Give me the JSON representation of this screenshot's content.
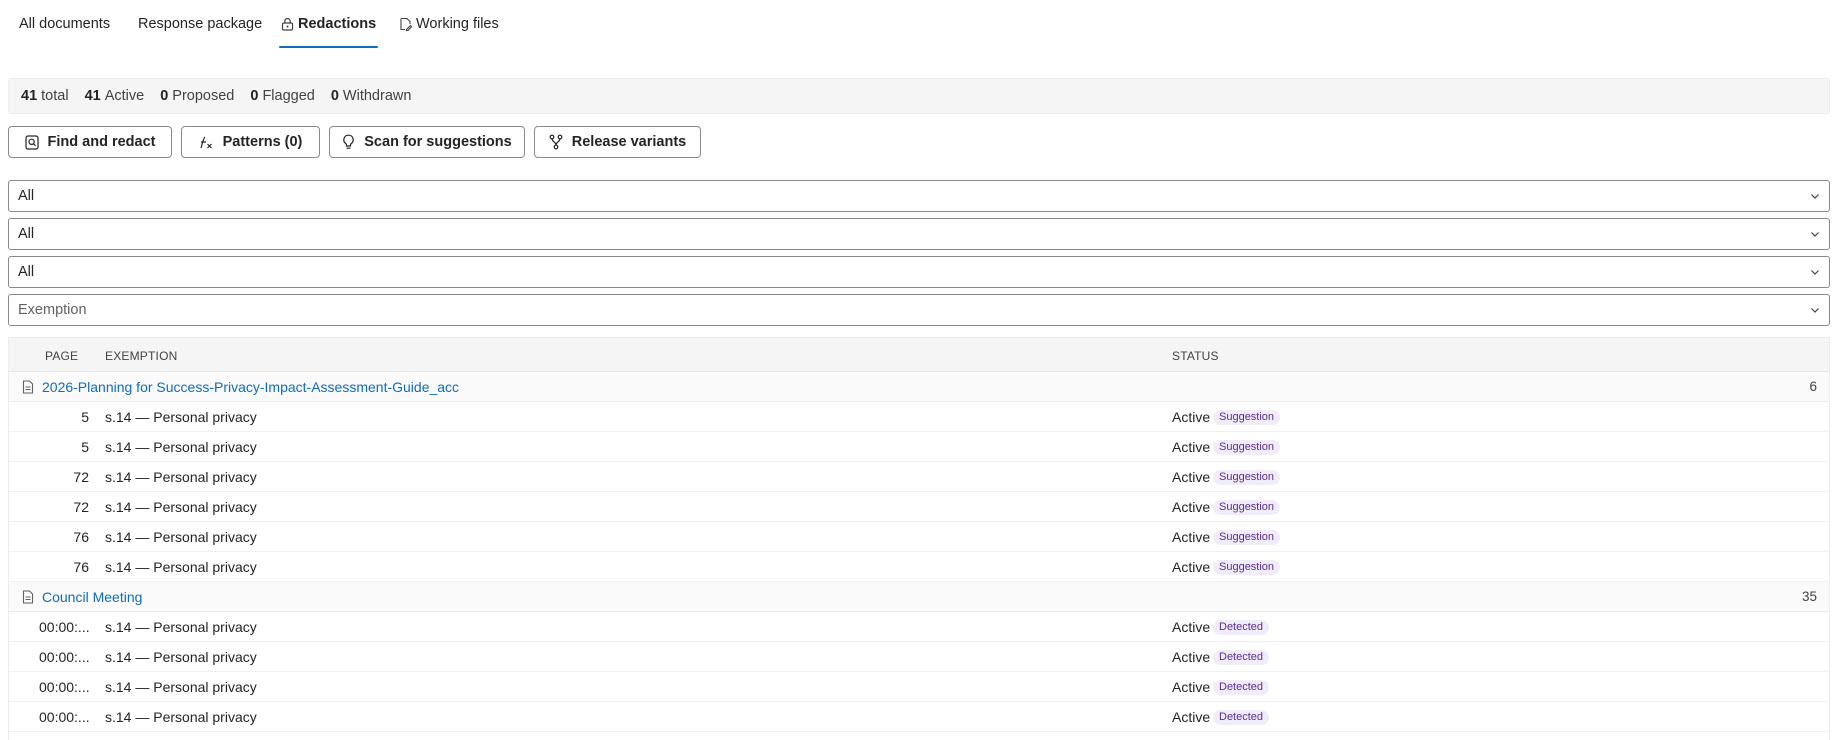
{
  "tabs": [
    {
      "label": "All documents",
      "icon": null
    },
    {
      "label": "Response package",
      "icon": null
    },
    {
      "label": "Redactions",
      "icon": "lock-icon",
      "active": true
    },
    {
      "label": "Working files",
      "icon": "document-edit-icon"
    }
  ],
  "summary": {
    "total": {
      "value": "41",
      "label": "total"
    },
    "active": {
      "value": "41",
      "label": "Active"
    },
    "proposed": {
      "value": "0",
      "label": "Proposed"
    },
    "flagged": {
      "value": "0",
      "label": "Flagged"
    },
    "withdrawn": {
      "value": "0",
      "label": "Withdrawn"
    }
  },
  "toolbar": {
    "find_redact": "Find and redact",
    "patterns": "Patterns (0)",
    "scan": "Scan for suggestions",
    "release": "Release variants"
  },
  "filters": {
    "filter1": "All",
    "filter2": "All",
    "filter3": "All",
    "exemption_placeholder": "Exemption"
  },
  "table": {
    "columns": {
      "page": "PAGE",
      "exemption": "EXEMPTION",
      "status": "STATUS"
    },
    "groups": [
      {
        "name": "2026-Planning for Success-Privacy-Impact-Assessment-Guide_acc",
        "count": "6",
        "rows": [
          {
            "page": "5",
            "exemption": "s.14 — Personal privacy",
            "status": "Active",
            "badge": "Suggestion"
          },
          {
            "page": "5",
            "exemption": "s.14 — Personal privacy",
            "status": "Active",
            "badge": "Suggestion"
          },
          {
            "page": "72",
            "exemption": "s.14 — Personal privacy",
            "status": "Active",
            "badge": "Suggestion"
          },
          {
            "page": "72",
            "exemption": "s.14 — Personal privacy",
            "status": "Active",
            "badge": "Suggestion"
          },
          {
            "page": "76",
            "exemption": "s.14 — Personal privacy",
            "status": "Active",
            "badge": "Suggestion"
          },
          {
            "page": "76",
            "exemption": "s.14 — Personal privacy",
            "status": "Active",
            "badge": "Suggestion"
          }
        ]
      },
      {
        "name": "Council Meeting",
        "count": "35",
        "rows": [
          {
            "page": "00:00:...",
            "exemption": "s.14 — Personal privacy",
            "status": "Active",
            "badge": "Detected"
          },
          {
            "page": "00:00:...",
            "exemption": "s.14 — Personal privacy",
            "status": "Active",
            "badge": "Detected"
          },
          {
            "page": "00:00:...",
            "exemption": "s.14 — Personal privacy",
            "status": "Active",
            "badge": "Detected"
          },
          {
            "page": "00:00:...",
            "exemption": "s.14 — Personal privacy",
            "status": "Active",
            "badge": "Detected"
          },
          {
            "page": "",
            "exemption": "",
            "status": "",
            "badge": ""
          }
        ]
      }
    ]
  },
  "colors": {
    "accent": "#0f6cbd",
    "badge_bg": "#f1ecfa",
    "badge_text": "#5b2d91"
  }
}
